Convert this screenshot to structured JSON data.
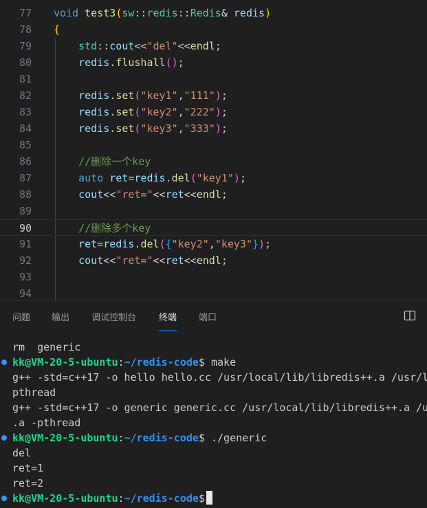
{
  "editor": {
    "lines": [
      {
        "num": "77",
        "tokens": [
          [
            "void",
            "kw"
          ],
          [
            " ",
            "plain"
          ],
          [
            "test3",
            "fn"
          ],
          [
            "(",
            "p1"
          ],
          [
            "sw",
            "ns"
          ],
          [
            "::",
            "plain"
          ],
          [
            "redis",
            "ns"
          ],
          [
            "::",
            "plain"
          ],
          [
            "Redis",
            "ns"
          ],
          [
            "&",
            "amp"
          ],
          [
            " ",
            "plain"
          ],
          [
            "redis",
            "var"
          ],
          [
            ")",
            "p1"
          ]
        ]
      },
      {
        "num": "78",
        "tokens": [
          [
            "{",
            "p1"
          ]
        ]
      },
      {
        "num": "79",
        "tokens": [
          [
            "    ",
            "plain"
          ],
          [
            "std",
            "ns"
          ],
          [
            "::",
            "plain"
          ],
          [
            "cout",
            "var"
          ],
          [
            "<<",
            "plain"
          ],
          [
            "\"del\"",
            "str"
          ],
          [
            "<<",
            "plain"
          ],
          [
            "endl",
            "fn"
          ],
          [
            ";",
            "plain"
          ]
        ]
      },
      {
        "num": "80",
        "tokens": [
          [
            "    ",
            "plain"
          ],
          [
            "redis",
            "var"
          ],
          [
            ".",
            "plain"
          ],
          [
            "flushall",
            "fn"
          ],
          [
            "()",
            "p2"
          ],
          [
            ";",
            "plain"
          ]
        ]
      },
      {
        "num": "81",
        "tokens": []
      },
      {
        "num": "82",
        "tokens": [
          [
            "    ",
            "plain"
          ],
          [
            "redis",
            "var"
          ],
          [
            ".",
            "plain"
          ],
          [
            "set",
            "fn"
          ],
          [
            "(",
            "p2"
          ],
          [
            "\"key1\"",
            "str"
          ],
          [
            ",",
            "plain"
          ],
          [
            "\"111\"",
            "str"
          ],
          [
            ")",
            "p2"
          ],
          [
            ";",
            "plain"
          ]
        ]
      },
      {
        "num": "83",
        "tokens": [
          [
            "    ",
            "plain"
          ],
          [
            "redis",
            "var"
          ],
          [
            ".",
            "plain"
          ],
          [
            "set",
            "fn"
          ],
          [
            "(",
            "p2"
          ],
          [
            "\"key2\"",
            "str"
          ],
          [
            ",",
            "plain"
          ],
          [
            "\"222\"",
            "str"
          ],
          [
            ")",
            "p2"
          ],
          [
            ";",
            "plain"
          ]
        ]
      },
      {
        "num": "84",
        "tokens": [
          [
            "    ",
            "plain"
          ],
          [
            "redis",
            "var"
          ],
          [
            ".",
            "plain"
          ],
          [
            "set",
            "fn"
          ],
          [
            "(",
            "p2"
          ],
          [
            "\"key3\"",
            "str"
          ],
          [
            ",",
            "plain"
          ],
          [
            "\"333\"",
            "str"
          ],
          [
            ")",
            "p2"
          ],
          [
            ";",
            "plain"
          ]
        ]
      },
      {
        "num": "85",
        "tokens": []
      },
      {
        "num": "86",
        "tokens": [
          [
            "    ",
            "plain"
          ],
          [
            "//删除一个key",
            "cmt"
          ]
        ]
      },
      {
        "num": "87",
        "tokens": [
          [
            "    ",
            "plain"
          ],
          [
            "auto",
            "kw"
          ],
          [
            " ",
            "plain"
          ],
          [
            "ret",
            "var"
          ],
          [
            "=",
            "plain"
          ],
          [
            "redis",
            "var"
          ],
          [
            ".",
            "plain"
          ],
          [
            "del",
            "fn"
          ],
          [
            "(",
            "p2"
          ],
          [
            "\"key1\"",
            "str"
          ],
          [
            ")",
            "p2"
          ],
          [
            ";",
            "plain"
          ]
        ]
      },
      {
        "num": "88",
        "tokens": [
          [
            "    ",
            "plain"
          ],
          [
            "cout",
            "var"
          ],
          [
            "<<",
            "plain"
          ],
          [
            "\"ret=\"",
            "str"
          ],
          [
            "<<",
            "plain"
          ],
          [
            "ret",
            "var"
          ],
          [
            "<<",
            "plain"
          ],
          [
            "endl",
            "fn"
          ],
          [
            ";",
            "plain"
          ]
        ]
      },
      {
        "num": "89",
        "tokens": []
      },
      {
        "num": "90",
        "tokens": [
          [
            "    ",
            "plain"
          ],
          [
            "//删除多个key",
            "cmt"
          ]
        ],
        "current": true
      },
      {
        "num": "91",
        "tokens": [
          [
            "    ",
            "plain"
          ],
          [
            "ret",
            "var"
          ],
          [
            "=",
            "plain"
          ],
          [
            "redis",
            "var"
          ],
          [
            ".",
            "plain"
          ],
          [
            "del",
            "fn"
          ],
          [
            "(",
            "p2"
          ],
          [
            "{",
            "p3"
          ],
          [
            "\"key2\"",
            "str"
          ],
          [
            ",",
            "plain"
          ],
          [
            "\"key3\"",
            "str"
          ],
          [
            "}",
            "p3"
          ],
          [
            ")",
            "p2"
          ],
          [
            ";",
            "plain"
          ]
        ]
      },
      {
        "num": "92",
        "tokens": [
          [
            "    ",
            "plain"
          ],
          [
            "cout",
            "var"
          ],
          [
            "<<",
            "plain"
          ],
          [
            "\"ret=\"",
            "str"
          ],
          [
            "<<",
            "plain"
          ],
          [
            "ret",
            "var"
          ],
          [
            "<<",
            "plain"
          ],
          [
            "endl",
            "fn"
          ],
          [
            ";",
            "plain"
          ]
        ]
      },
      {
        "num": "93",
        "tokens": []
      },
      {
        "num": "94",
        "tokens": []
      }
    ]
  },
  "panel": {
    "tabs": [
      "问题",
      "输出",
      "调试控制台",
      "终端",
      "端口"
    ],
    "active_tab": "终端",
    "layout_icon": "split-layout-icon"
  },
  "terminal": {
    "lines": [
      {
        "type": "out",
        "text": "rm  generic"
      },
      {
        "type": "prompt",
        "user": "kk@VM-20-5-ubuntu",
        "sep": ":",
        "path": "~/redis-code",
        "sym": "$",
        "cmd": " make"
      },
      {
        "type": "out",
        "text": "g++ -std=c++17 -o hello hello.cc /usr/local/lib/libredis++.a /usr/l"
      },
      {
        "type": "out",
        "text": "pthread"
      },
      {
        "type": "out",
        "text": "g++ -std=c++17 -o generic generic.cc /usr/local/lib/libredis++.a /u"
      },
      {
        "type": "out",
        "text": ".a -pthread"
      },
      {
        "type": "prompt",
        "user": "kk@VM-20-5-ubuntu",
        "sep": ":",
        "path": "~/redis-code",
        "sym": "$",
        "cmd": " ./generic"
      },
      {
        "type": "out",
        "text": "del"
      },
      {
        "type": "out",
        "text": "ret=1"
      },
      {
        "type": "out",
        "text": "ret=2"
      },
      {
        "type": "prompt",
        "user": "kk@VM-20-5-ubuntu",
        "sep": ":",
        "path": "~/redis-code",
        "sym": "$",
        "cmd": "",
        "cursor": true
      }
    ]
  },
  "colors": {
    "background": "#1f1f1f",
    "accent": "#0078d4",
    "prompt_user": "#23d18b",
    "prompt_path": "#3b8eea",
    "decoration_dot": "#3794ff"
  }
}
